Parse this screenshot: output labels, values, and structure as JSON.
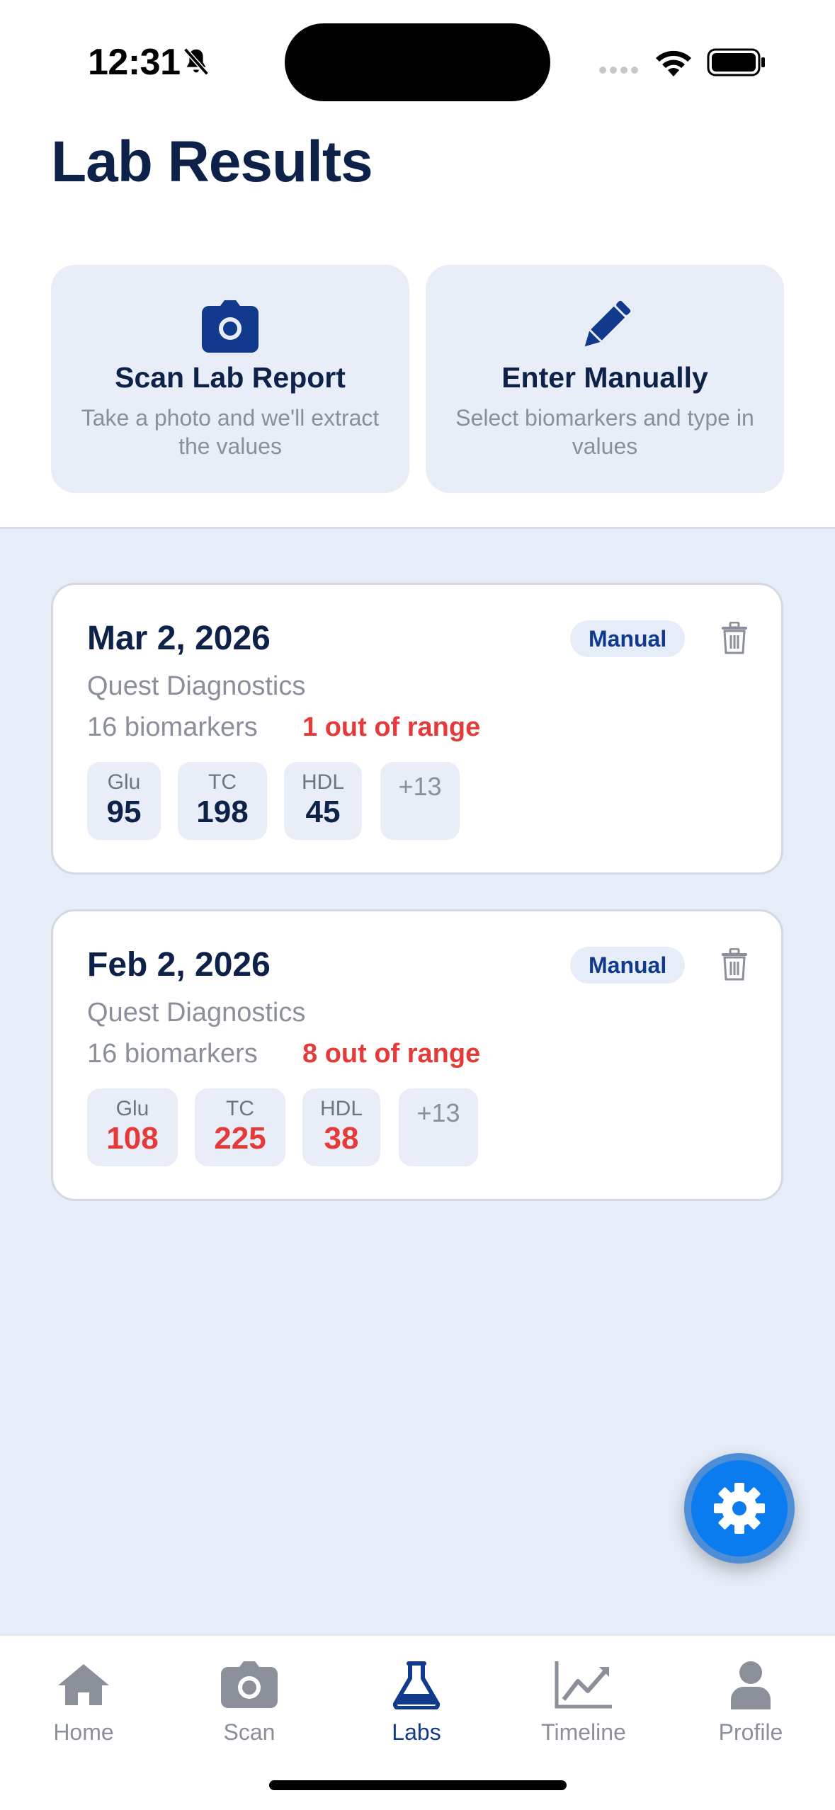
{
  "status_bar": {
    "time": "12:31"
  },
  "page_title": "Lab Results",
  "actions": [
    {
      "title": "Scan Lab Report",
      "subtitle": "Take a photo and we'll extract the values",
      "icon": "camera-icon"
    },
    {
      "title": "Enter Manually",
      "subtitle": "Select biomarkers and type in values",
      "icon": "pencil-icon"
    }
  ],
  "lab_results": [
    {
      "date": "Mar 2, 2026",
      "badge": "Manual",
      "provider": "Quest Diagnostics",
      "biomarker_count": "16 biomarkers",
      "out_of_range": "1 out of range",
      "chips": [
        {
          "label": "Glu",
          "value": "95",
          "flagged": false
        },
        {
          "label": "TC",
          "value": "198",
          "flagged": false
        },
        {
          "label": "HDL",
          "value": "45",
          "flagged": false
        }
      ],
      "more": "+13"
    },
    {
      "date": "Feb 2, 2026",
      "badge": "Manual",
      "provider": "Quest Diagnostics",
      "biomarker_count": "16 biomarkers",
      "out_of_range": "8 out of range",
      "chips": [
        {
          "label": "Glu",
          "value": "108",
          "flagged": true
        },
        {
          "label": "TC",
          "value": "225",
          "flagged": true
        },
        {
          "label": "HDL",
          "value": "38",
          "flagged": true
        }
      ],
      "more": "+13"
    }
  ],
  "tabs": [
    {
      "label": "Home",
      "icon": "home-icon",
      "active": false
    },
    {
      "label": "Scan",
      "icon": "camera-icon",
      "active": false
    },
    {
      "label": "Labs",
      "icon": "flask-icon",
      "active": true
    },
    {
      "label": "Timeline",
      "icon": "chart-line-icon",
      "active": false
    },
    {
      "label": "Profile",
      "icon": "person-icon",
      "active": false
    }
  ],
  "colors": {
    "primary": "#123a8c",
    "title": "#0d2149",
    "danger": "#e53a3a",
    "muted": "#8a8f99",
    "background_tint": "#e6edf8",
    "fab": "#0a7cf0"
  }
}
